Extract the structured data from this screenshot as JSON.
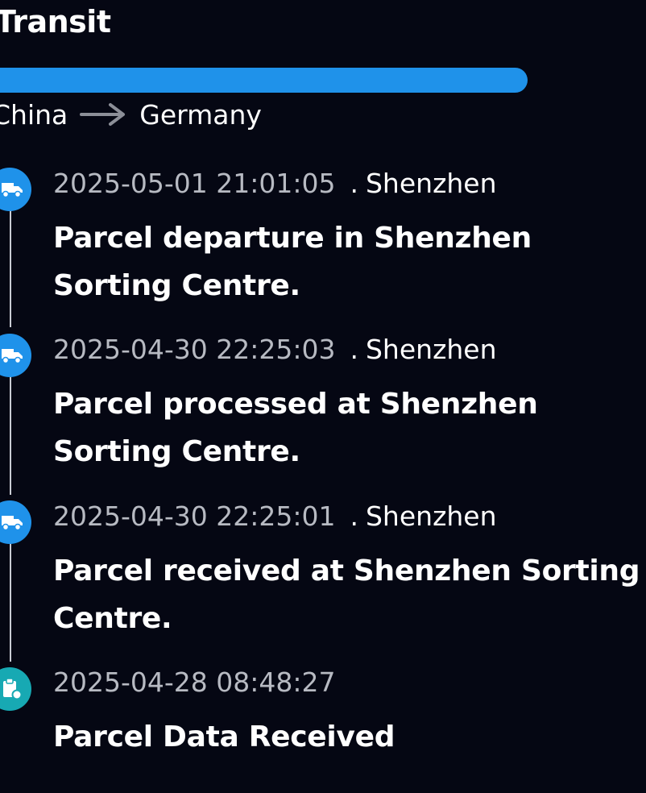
{
  "header": {
    "status_title": "Transit",
    "progress": 1.0,
    "accent_color": "#1f92ea"
  },
  "route": {
    "origin": "China",
    "destination": "Germany",
    "arrow_icon": "arrow-right-icon"
  },
  "events": [
    {
      "time": "2025-05-01 21:01:05",
      "separator": ".",
      "location": "Shenzhen",
      "description": "Parcel departure in Shenzhen Sorting Centre.",
      "icon": "truck-icon",
      "icon_color": "#1f92ea"
    },
    {
      "time": "2025-04-30 22:25:03",
      "separator": ".",
      "location": "Shenzhen",
      "description": "Parcel processed at Shenzhen Sorting Centre.",
      "icon": "truck-icon",
      "icon_color": "#1f92ea"
    },
    {
      "time": "2025-04-30 22:25:01",
      "separator": ".",
      "location": "Shenzhen",
      "description": "Parcel received at Shenzhen Sorting Centre.",
      "icon": "truck-icon",
      "icon_color": "#1f92ea"
    },
    {
      "time": "2025-04-28 08:48:27",
      "description": "Parcel Data Received",
      "icon": "clipboard-icon",
      "icon_color": "#17a9b3"
    }
  ]
}
